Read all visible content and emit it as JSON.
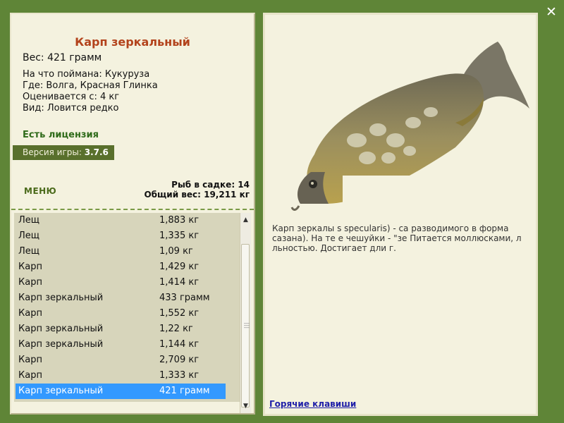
{
  "fish": {
    "title": "Карп зеркальный",
    "weight": "Вес: 421 грамм",
    "caught_on": "На что поймана: Кукуруза",
    "where": "Где: Волга, Красная Глинка",
    "rating": "Оценивается с: 4 кг",
    "type": "Вид: Ловится редко"
  },
  "license": "Есть лицензия",
  "version": {
    "label": "Версия игры: ",
    "value": "3.7.6"
  },
  "menu": "МЕНЮ",
  "keep_net": {
    "count": "Рыб в садке: 14",
    "total": "Общий вес: 19,211 кг"
  },
  "catch_list": [
    {
      "name": "Лещ",
      "weight": "1,883 кг"
    },
    {
      "name": "Лещ",
      "weight": "1,335 кг"
    },
    {
      "name": "Лещ",
      "weight": "1,09 кг"
    },
    {
      "name": "Карп",
      "weight": "1,429 кг"
    },
    {
      "name": "Карп",
      "weight": "1,414 кг"
    },
    {
      "name": "Карп зеркальный",
      "weight": "433 грамм"
    },
    {
      "name": "Карп",
      "weight": "1,552 кг"
    },
    {
      "name": "Карп зеркальный",
      "weight": "1,22 кг"
    },
    {
      "name": "Карп зеркальный",
      "weight": "1,144 кг"
    },
    {
      "name": "Карп",
      "weight": "2,709 кг"
    },
    {
      "name": "Карп",
      "weight": "1,333 кг"
    },
    {
      "name": "Карп зеркальный",
      "weight": "421 грамм",
      "selected": true
    }
  ],
  "description": "Карп зеркалы                                          s specularis) - ca                                   разводимого в                                          форма сазана). На те                                        е чешуйки - \"зе                                   Питается моллюсками, л                               льностью. Достигает дли                              г.",
  "hotkeys": "Горячие клавиши",
  "close_icon": "close-icon",
  "colors": {
    "background": "#5f8537",
    "panel": "#f4f2df",
    "title": "#b3431c",
    "selection": "#3399ff"
  }
}
